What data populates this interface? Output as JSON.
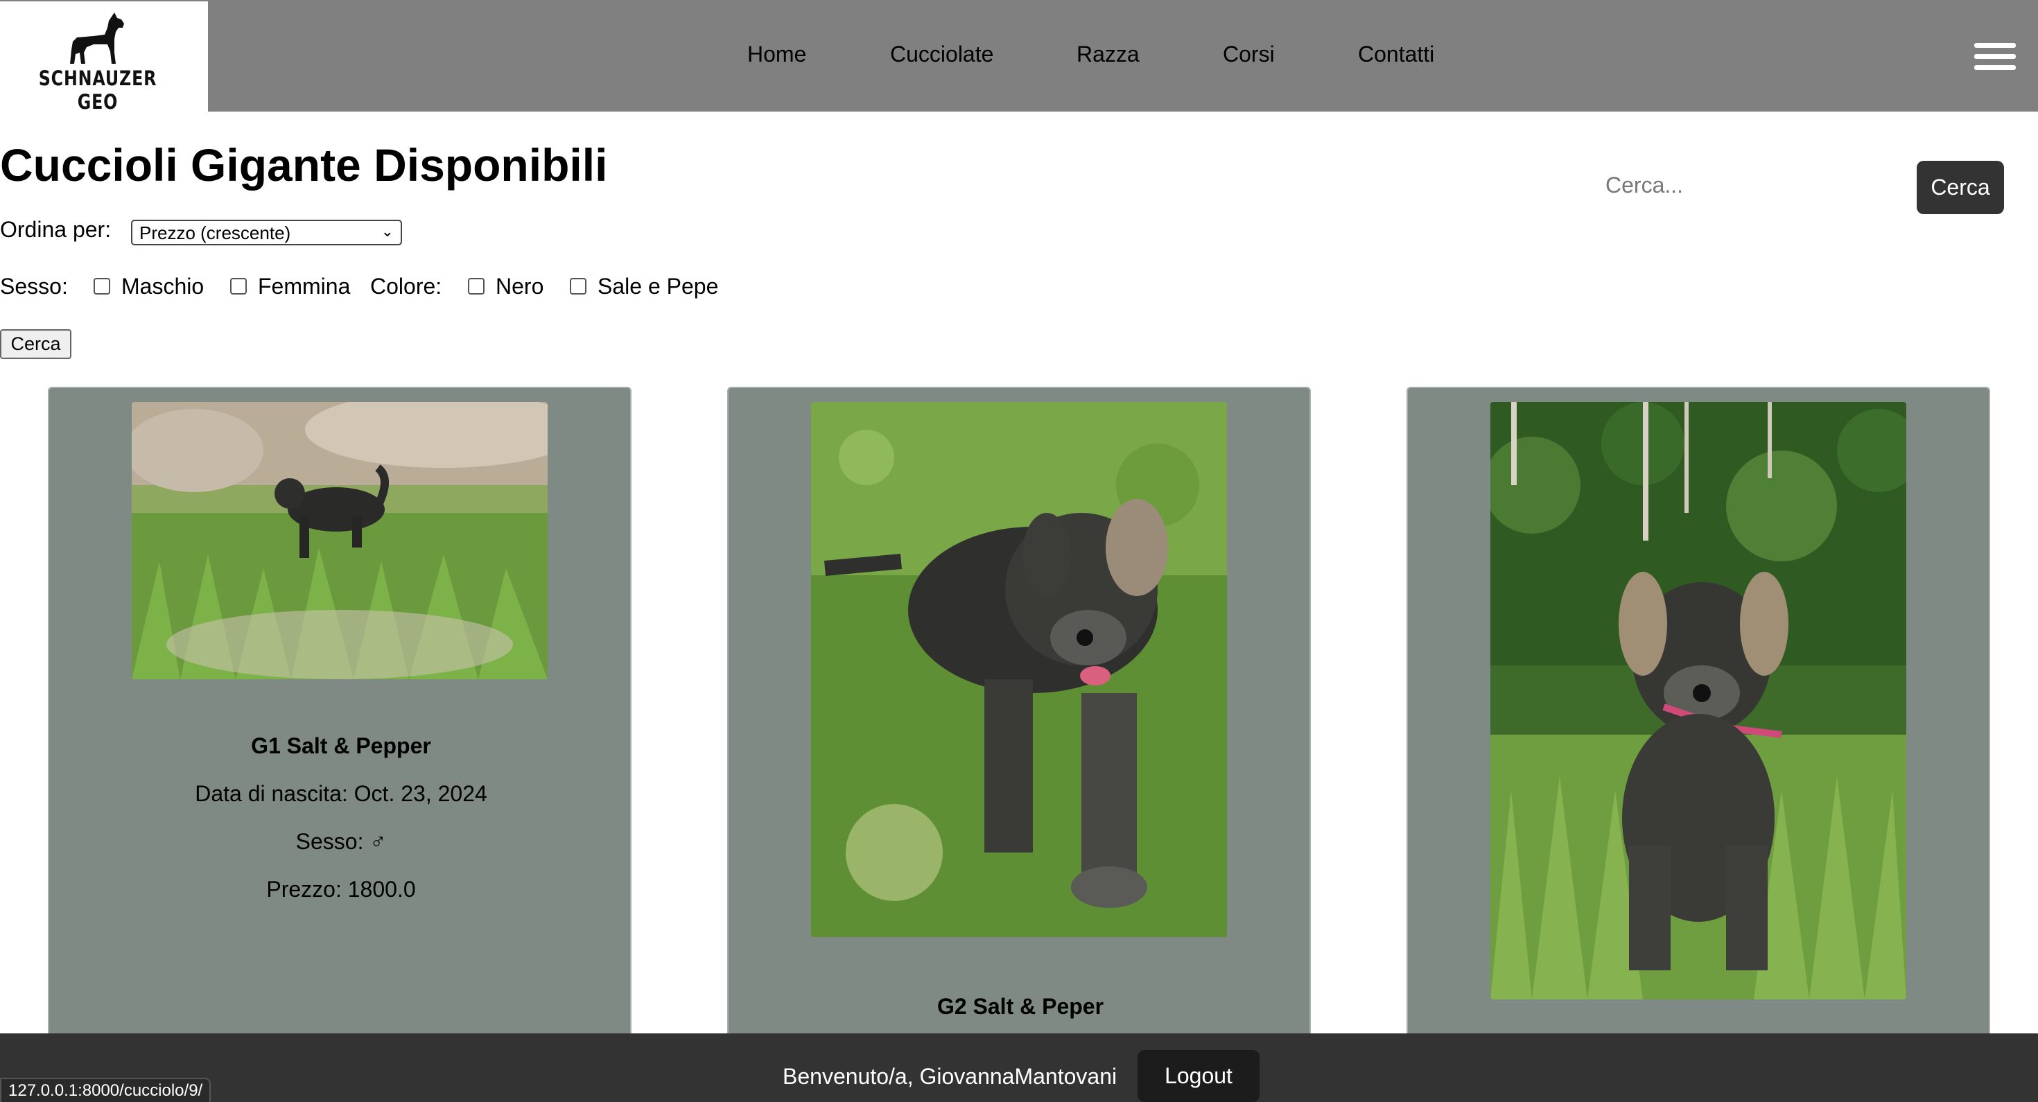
{
  "header": {
    "logo_text": "SCHNAUZER GEO",
    "nav": [
      "Home",
      "Cucciolate",
      "Razza",
      "Corsi",
      "Contatti"
    ]
  },
  "main": {
    "title": "Cuccioli Gigante Disponibili",
    "sort": {
      "label": "Ordina per:",
      "selected": "Prezzo (crescente)"
    },
    "filters": {
      "sex_label": "Sesso:",
      "male": "Maschio",
      "female": "Femmina",
      "color_label": "Colore:",
      "black": "Nero",
      "salt_pepper": "Sale e Pepe",
      "submit": "Cerca"
    },
    "search": {
      "placeholder": "Cerca...",
      "button": "Cerca"
    },
    "cards": [
      {
        "name": "G1 Salt & Pepper",
        "birth": "Data di nascita: Oct. 23, 2024",
        "sex": "Sesso: ♂",
        "price": "Prezzo: 1800.0"
      },
      {
        "name": "G2 Salt & Peper"
      },
      {
        "name": ""
      }
    ]
  },
  "footer": {
    "welcome": "Benvenuto/a, GiovannaMantovani",
    "logout": "Logout"
  },
  "status_bar": {
    "url": "127.0.0.1:8000/cucciolo/9/"
  },
  "colors": {
    "header_bg": "#808080",
    "card_bg": "#7f8a85",
    "footer_bg": "#333333",
    "button_dark": "#333333"
  }
}
